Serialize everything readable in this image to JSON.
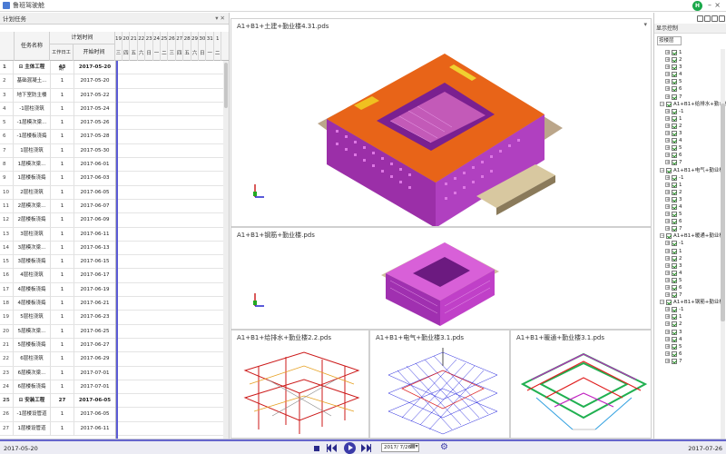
{
  "app": {
    "title": "鲁班驾驶舱"
  },
  "left_panel": {
    "title": "计划任务",
    "col_group": "计划时间",
    "col_name": "任务名称",
    "col_duration": "工作日工期",
    "col_start": "开始时间",
    "days": [
      "19",
      "20",
      "21",
      "22",
      "23",
      "24",
      "25",
      "26",
      "27",
      "28",
      "29",
      "30",
      "31",
      "1"
    ],
    "weekdays": [
      "三",
      "四",
      "五",
      "六",
      "日",
      "一",
      "二",
      "三",
      "四",
      "五",
      "六",
      "日",
      "一",
      "二"
    ],
    "rows": [
      {
        "n": "1",
        "name": "主体工程",
        "dur": "43",
        "start": "2017-05-20",
        "bold": true
      },
      {
        "n": "2",
        "name": "基础混凝土...",
        "dur": "1",
        "start": "2017-05-20"
      },
      {
        "n": "3",
        "name": "地下室防主楼",
        "dur": "1",
        "start": "2017-05-22"
      },
      {
        "n": "4",
        "name": "-1层柱浇筑",
        "dur": "1",
        "start": "2017-05-24"
      },
      {
        "n": "5",
        "name": "-1层模次梁...",
        "dur": "1",
        "start": "2017-05-26"
      },
      {
        "n": "6",
        "name": "-1层楼板浇捣",
        "dur": "1",
        "start": "2017-05-28"
      },
      {
        "n": "7",
        "name": "1层柱浇筑",
        "dur": "1",
        "start": "2017-05-30"
      },
      {
        "n": "8",
        "name": "1层模次梁...",
        "dur": "1",
        "start": "2017-06-01"
      },
      {
        "n": "9",
        "name": "1层楼板浇捣",
        "dur": "1",
        "start": "2017-06-03"
      },
      {
        "n": "10",
        "name": "2层柱浇筑",
        "dur": "1",
        "start": "2017-06-05"
      },
      {
        "n": "11",
        "name": "2层模次梁...",
        "dur": "1",
        "start": "2017-06-07"
      },
      {
        "n": "12",
        "name": "2层楼板浇捣",
        "dur": "1",
        "start": "2017-06-09"
      },
      {
        "n": "13",
        "name": "3层柱浇筑",
        "dur": "1",
        "start": "2017-06-11"
      },
      {
        "n": "14",
        "name": "3层模次梁...",
        "dur": "1",
        "start": "2017-06-13"
      },
      {
        "n": "15",
        "name": "3层楼板浇捣",
        "dur": "1",
        "start": "2017-06-15"
      },
      {
        "n": "16",
        "name": "4层柱浇筑",
        "dur": "1",
        "start": "2017-06-17"
      },
      {
        "n": "17",
        "name": "4层楼板浇捣",
        "dur": "1",
        "start": "2017-06-19"
      },
      {
        "n": "18",
        "name": "4层楼板浇捣",
        "dur": "1",
        "start": "2017-06-21"
      },
      {
        "n": "19",
        "name": "5层柱浇筑",
        "dur": "1",
        "start": "2017-06-23"
      },
      {
        "n": "20",
        "name": "5层模次梁...",
        "dur": "1",
        "start": "2017-06-25"
      },
      {
        "n": "21",
        "name": "5层楼板浇捣",
        "dur": "1",
        "start": "2017-06-27"
      },
      {
        "n": "22",
        "name": "6层柱浇筑",
        "dur": "1",
        "start": "2017-06-29"
      },
      {
        "n": "23",
        "name": "6层模次梁...",
        "dur": "1",
        "start": "2017-07-01"
      },
      {
        "n": "24",
        "name": "6层楼板浇捣",
        "dur": "1",
        "start": "2017-07-01"
      },
      {
        "n": "25",
        "name": "安装工程",
        "dur": "27",
        "start": "2017-06-05",
        "bold": true
      },
      {
        "n": "26",
        "name": "-1层楼设管道",
        "dur": "1",
        "start": "2017-06-05"
      },
      {
        "n": "27",
        "name": "1层楼设管道",
        "dur": "1",
        "start": "2017-06-11"
      }
    ]
  },
  "viewports": {
    "vp1": "A1+B1+土建+勤业楼4.31.pds",
    "vp2": "A1+B1+钢筋+勤业楼.pds",
    "vp3": "A1+B1+给排水+勤业楼2.2.pds",
    "vp4": "A1+B1+电气+勤业楼3.1.pds",
    "vp5": "A1+B1+暖通+勤业楼3.1.pds"
  },
  "right_panel": {
    "title": "显示控制",
    "select": "按楼层",
    "tree": [
      {
        "t": "1",
        "lvl": 1
      },
      {
        "t": "2",
        "lvl": 1
      },
      {
        "t": "3",
        "lvl": 1
      },
      {
        "t": "4",
        "lvl": 1
      },
      {
        "t": "5",
        "lvl": 1
      },
      {
        "t": "6",
        "lvl": 1
      },
      {
        "t": "7",
        "lvl": 1
      },
      {
        "t": "A1+B1+给排水+勤业楼",
        "lvl": 0
      },
      {
        "t": "-1",
        "lvl": 1
      },
      {
        "t": "1",
        "lvl": 1
      },
      {
        "t": "2",
        "lvl": 1
      },
      {
        "t": "3",
        "lvl": 1
      },
      {
        "t": "4",
        "lvl": 1
      },
      {
        "t": "5",
        "lvl": 1
      },
      {
        "t": "6",
        "lvl": 1
      },
      {
        "t": "7",
        "lvl": 1
      },
      {
        "t": "A1+B1+电气+勤业楼",
        "lvl": 0
      },
      {
        "t": "-1",
        "lvl": 1
      },
      {
        "t": "1",
        "lvl": 1
      },
      {
        "t": "2",
        "lvl": 1
      },
      {
        "t": "3",
        "lvl": 1
      },
      {
        "t": "4",
        "lvl": 1
      },
      {
        "t": "5",
        "lvl": 1
      },
      {
        "t": "6",
        "lvl": 1
      },
      {
        "t": "7",
        "lvl": 1
      },
      {
        "t": "A1+B1+暖通+勤业楼",
        "lvl": 0
      },
      {
        "t": "-1",
        "lvl": 1
      },
      {
        "t": "1",
        "lvl": 1
      },
      {
        "t": "2",
        "lvl": 1
      },
      {
        "t": "3",
        "lvl": 1
      },
      {
        "t": "4",
        "lvl": 1
      },
      {
        "t": "5",
        "lvl": 1
      },
      {
        "t": "6",
        "lvl": 1
      },
      {
        "t": "7",
        "lvl": 1
      },
      {
        "t": "A1+B1+钢筋+勤业楼",
        "lvl": 0
      },
      {
        "t": "-1",
        "lvl": 1
      },
      {
        "t": "1",
        "lvl": 1
      },
      {
        "t": "2",
        "lvl": 1
      },
      {
        "t": "3",
        "lvl": 1
      },
      {
        "t": "4",
        "lvl": 1
      },
      {
        "t": "5",
        "lvl": 1
      },
      {
        "t": "6",
        "lvl": 1
      },
      {
        "t": "7",
        "lvl": 1
      }
    ]
  },
  "timeline": {
    "start": "2017-05-20",
    "end": "2017-07-26",
    "current": "2017/ 7/26"
  },
  "colors": {
    "accent": "#3b3ba8",
    "magenta": "#c020c0",
    "orange": "#e85a10"
  }
}
